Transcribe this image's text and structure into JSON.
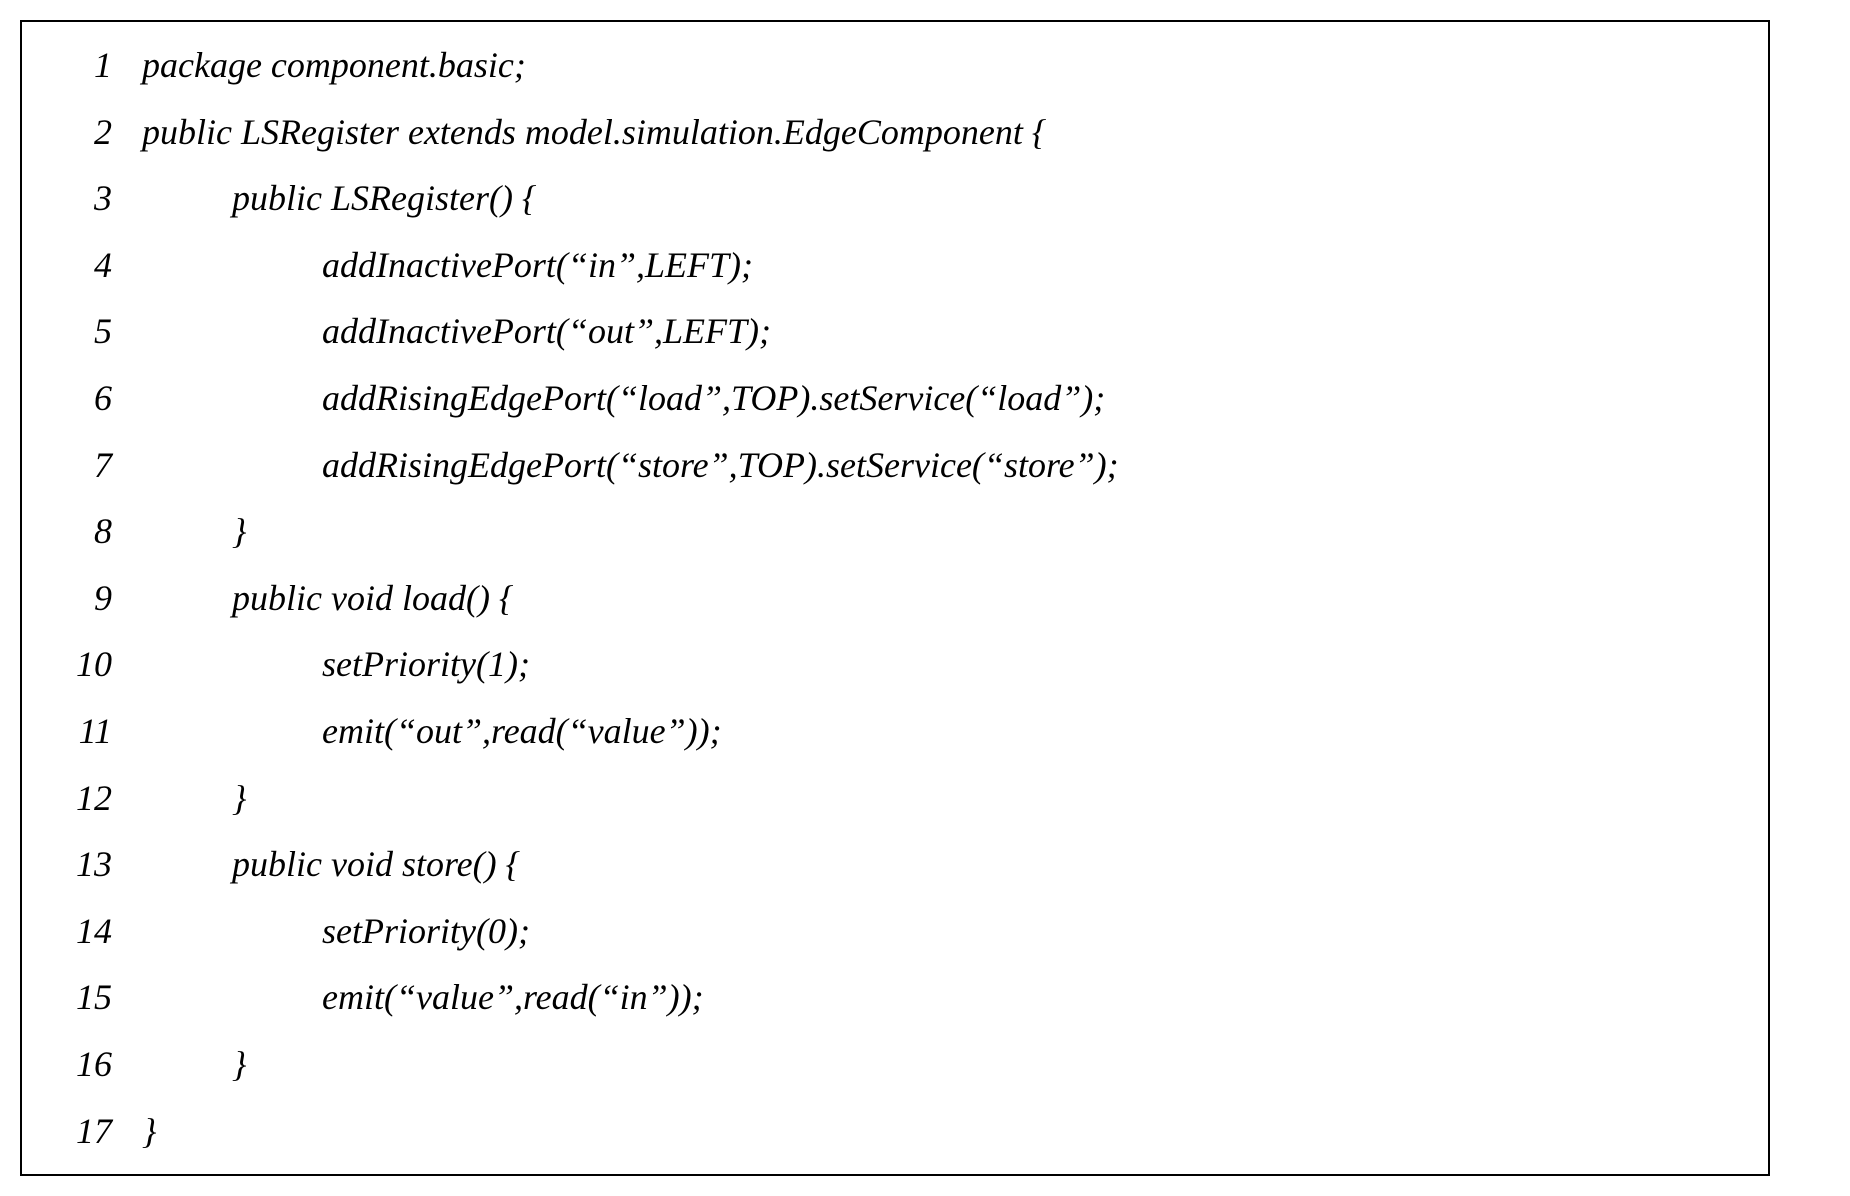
{
  "code": {
    "lines": [
      {
        "n": "1",
        "indent": 0,
        "text": "package component.basic;"
      },
      {
        "n": "2",
        "indent": 0,
        "text": "public LSRegister extends model.simulation.EdgeComponent {"
      },
      {
        "n": "3",
        "indent": 1,
        "text": "public LSRegister() {"
      },
      {
        "n": "4",
        "indent": 2,
        "text": "addInactivePort(“in”,LEFT);"
      },
      {
        "n": "5",
        "indent": 2,
        "text": "addInactivePort(“out”,LEFT);"
      },
      {
        "n": "6",
        "indent": 2,
        "text": "addRisingEdgePort(“load”,TOP).setService(“load”);"
      },
      {
        "n": "7",
        "indent": 2,
        "text": "addRisingEdgePort(“store”,TOP).setService(“store”);"
      },
      {
        "n": "8",
        "indent": 1,
        "text": "}"
      },
      {
        "n": "9",
        "indent": 1,
        "text": "public void load() {"
      },
      {
        "n": "10",
        "indent": 2,
        "text": "setPriority(1);"
      },
      {
        "n": "11",
        "indent": 2,
        "text": "emit(“out”,read(“value”));"
      },
      {
        "n": "12",
        "indent": 1,
        "text": "}"
      },
      {
        "n": "13",
        "indent": 1,
        "text": "public void store() {"
      },
      {
        "n": "14",
        "indent": 2,
        "text": "setPriority(0);"
      },
      {
        "n": "15",
        "indent": 2,
        "text": "emit(“value”,read(“in”));"
      },
      {
        "n": "16",
        "indent": 1,
        "text": "}"
      },
      {
        "n": "17",
        "indent": 0,
        "text": "}"
      }
    ],
    "indent_unit": "          "
  }
}
